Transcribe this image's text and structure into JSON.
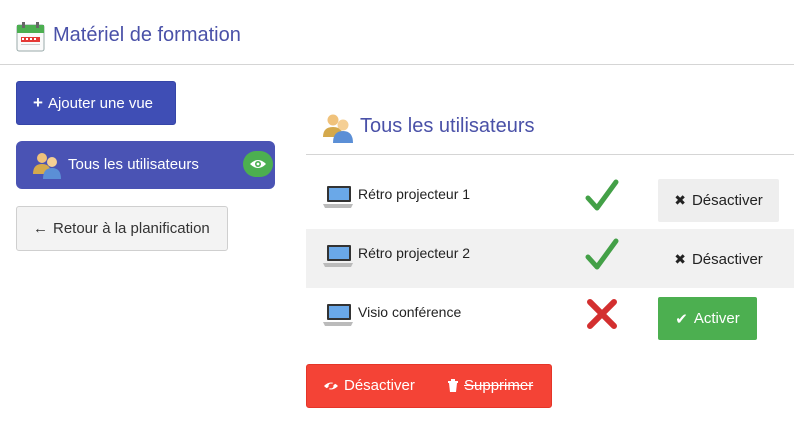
{
  "header": {
    "title": "Matériel de formation",
    "icon": "calendar-icon"
  },
  "sidebar": {
    "add_view_label": "Ajouter une vue",
    "view_item": {
      "label": "Tous les utilisateurs",
      "icon": "users-icon",
      "badge_icon": "eye-icon",
      "badge_color": "#4caf50"
    },
    "back_label": "Retour à la planification"
  },
  "main": {
    "section_title": "Tous les utilisateurs",
    "rows": [
      {
        "name": "Rétro projecteur 1",
        "status": "enabled",
        "action_label": "Désactiver"
      },
      {
        "name": "Rétro projecteur 2",
        "status": "enabled",
        "action_label": "Désactiver"
      },
      {
        "name": "Visio conférence",
        "status": "disabled",
        "action_label": "Activer"
      }
    ],
    "footer": {
      "deactivate_label": "Désactiver",
      "delete_label": "Supprimer"
    }
  },
  "colors": {
    "primary": "#3f4eb5",
    "title": "#4a51a8",
    "success": "#4caf50",
    "danger": "#f44336"
  }
}
